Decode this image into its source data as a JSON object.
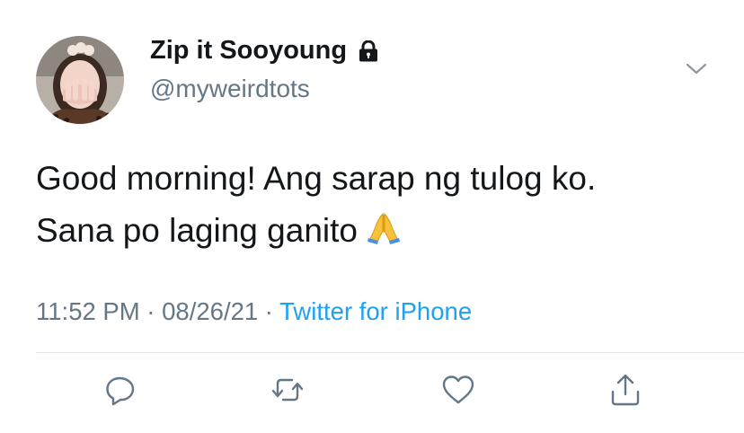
{
  "author": {
    "display_name": "Zip it Sooyoung",
    "handle": "@myweirdtots",
    "avatar_icon": "profile-photo",
    "protected_icon": "lock-icon"
  },
  "tweet": {
    "lines": [
      "Good morning! Ang sarap ng tulog ko.",
      "Sana po laging ganito"
    ],
    "emoji": "🙏"
  },
  "meta": {
    "time": "11:52 PM",
    "separator": " · ",
    "date": "08/26/21",
    "source": "Twitter for iPhone"
  },
  "actions": [
    {
      "icon": "reply-icon"
    },
    {
      "icon": "retweet-icon"
    },
    {
      "icon": "like-icon"
    },
    {
      "icon": "share-icon"
    }
  ],
  "colors": {
    "text": "#14171a",
    "secondary": "#657786",
    "link": "#1da1f2",
    "divider": "#e1e8ed"
  }
}
